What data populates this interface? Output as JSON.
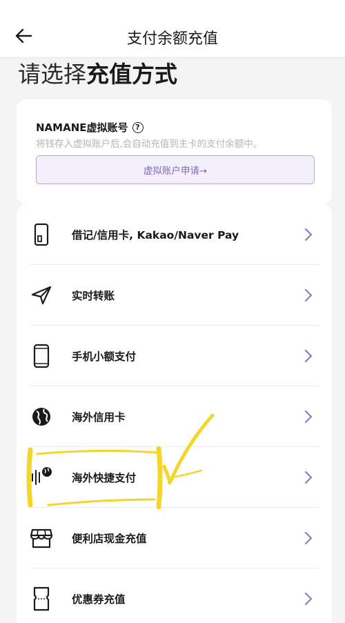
{
  "header": {
    "title": "支付余额充值",
    "back_icon": "arrow-left-icon"
  },
  "heading": {
    "light": "请选择",
    "bold": "充值方式"
  },
  "virtual_account": {
    "title": "NAMANE虚拟账号",
    "help_icon": "question-circle-icon",
    "description": "将钱存入虚拟账户后,会自动充值到主卡的支付余额中。",
    "apply_button": "虚拟账户申请→"
  },
  "methods": [
    {
      "label": "借记/信用卡, Kakao/Naver Pay",
      "icon": "card-icon"
    },
    {
      "label": "实时转账",
      "icon": "paper-plane-icon"
    },
    {
      "label": "手机小额支付",
      "icon": "mobile-phone-icon"
    },
    {
      "label": "海外信用卡",
      "icon": "globe-icon"
    },
    {
      "label": "海外快捷支付",
      "icon": "contactless-globe-icon"
    },
    {
      "label": "便利店现金充值",
      "icon": "store-icon"
    },
    {
      "label": "优惠券充值",
      "icon": "ticket-icon"
    }
  ],
  "colors": {
    "accent": "#8467b8",
    "accent_border": "#b9a6d9",
    "chevron": "#8f7ac2",
    "annotation": "#f4d52a",
    "background": "#f4f4f5"
  }
}
